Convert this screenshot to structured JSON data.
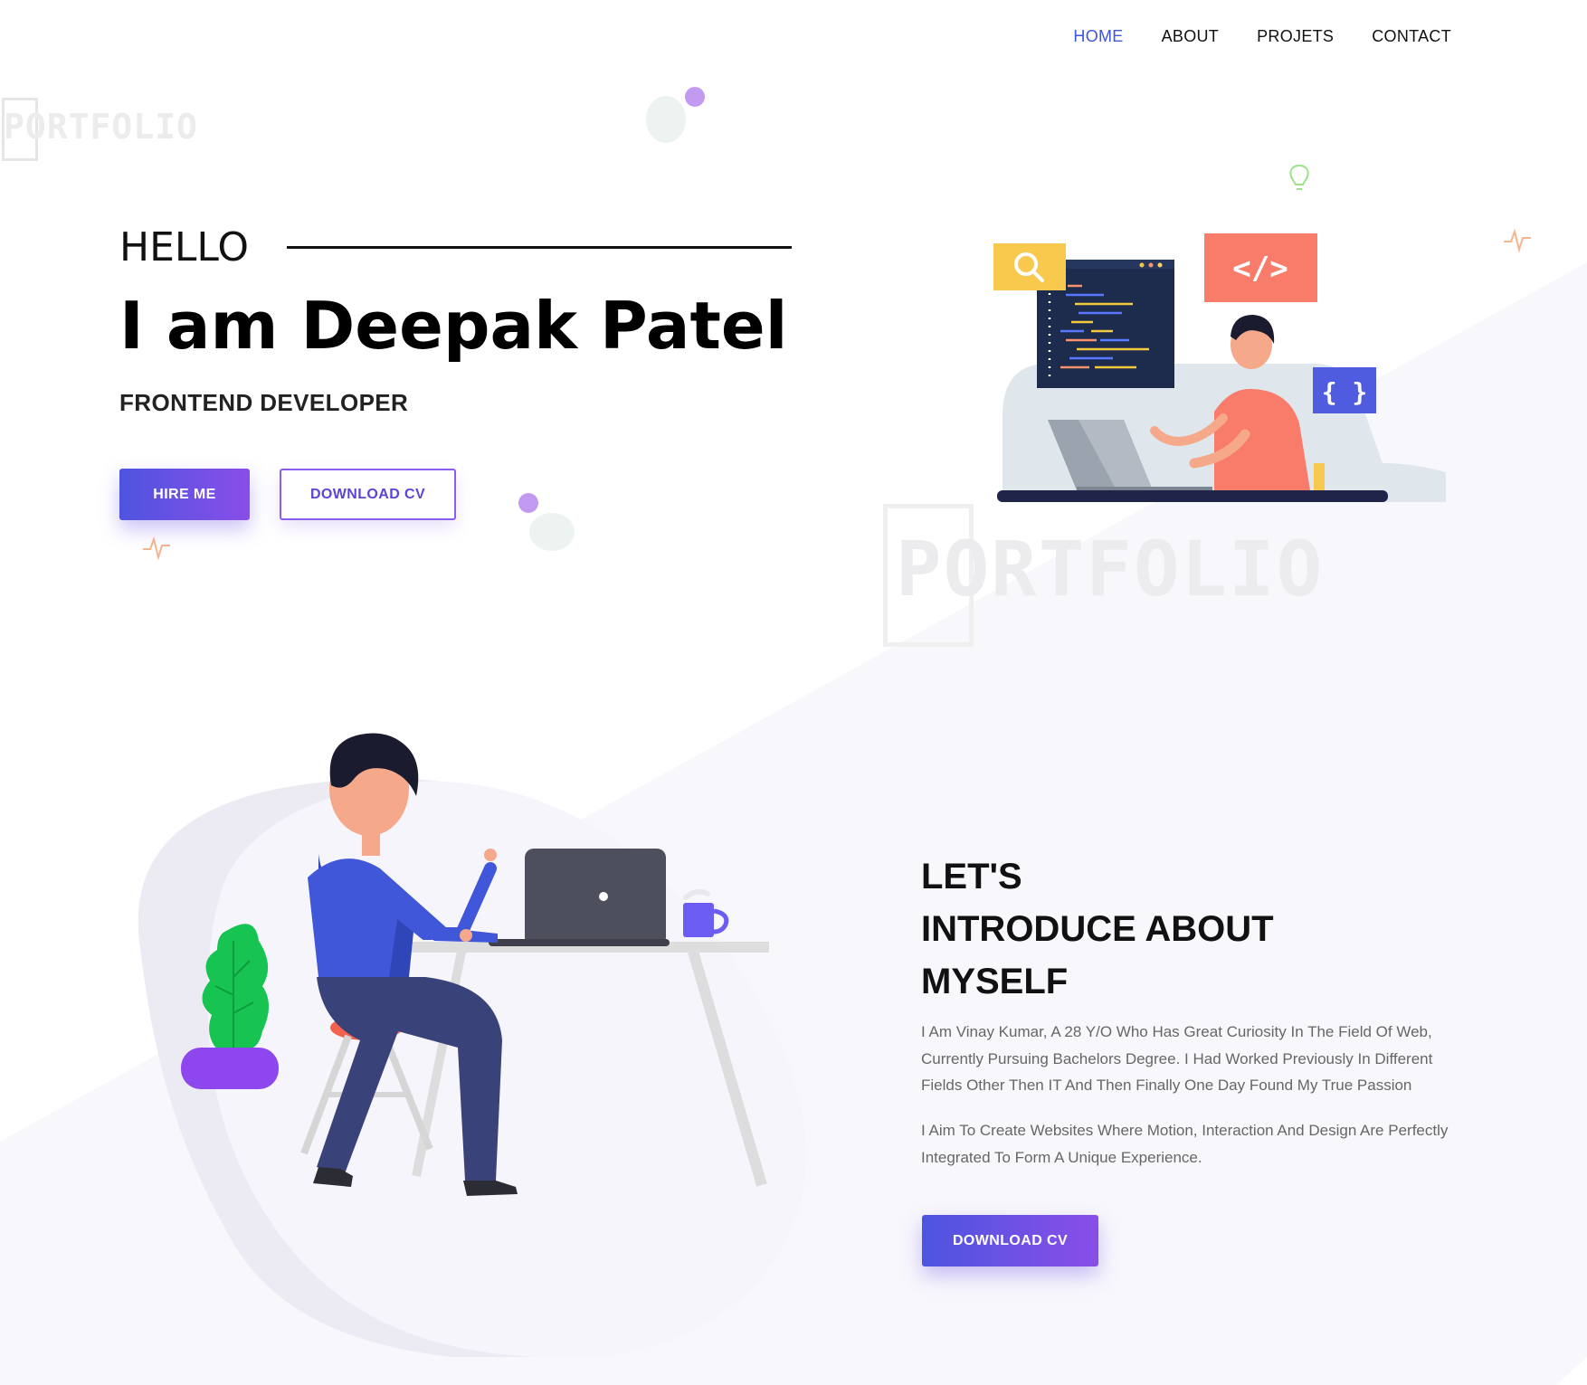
{
  "nav": {
    "items": [
      {
        "label": "HOME",
        "active": true
      },
      {
        "label": "ABOUT",
        "active": false
      },
      {
        "label": "PROJETS",
        "active": false
      },
      {
        "label": "CONTACT",
        "active": false
      }
    ]
  },
  "logo": {
    "text": "PORTFOLIO"
  },
  "hero": {
    "greeting": "HELLO",
    "name": "I am Deepak Patel",
    "role": "FRONTEND DEVELOPER",
    "hire_button": "HIRE ME",
    "download_button": "DOWNLOAD CV",
    "illustration_tags": {
      "code": "</>",
      "braces": "{ }"
    }
  },
  "about": {
    "title_lines": [
      "LET'S",
      "INTRODUCE ABOUT",
      "MYSELF"
    ],
    "paragraph1": "I Am Vinay Kumar, A 28 Y/O Who Has Great Curiosity In The Field Of Web, Currently Pursuing Bachelors Degree. I Had Worked Previously In Different Fields Other Then IT And Then Finally One Day Found My True Passion",
    "paragraph2": "I Aim To Create Websites Where Motion, Interaction And Design Are Perfectly Integrated To Form A Unique Experience.",
    "download_button": "DOWNLOAD CV"
  },
  "colors": {
    "accent": "#3f56d8",
    "button_gradient_start": "#4e54e0",
    "button_gradient_end": "#8a4ee8",
    "text_dark": "#111111",
    "text_muted": "#666666",
    "section_bg": "#f8f7fc"
  }
}
